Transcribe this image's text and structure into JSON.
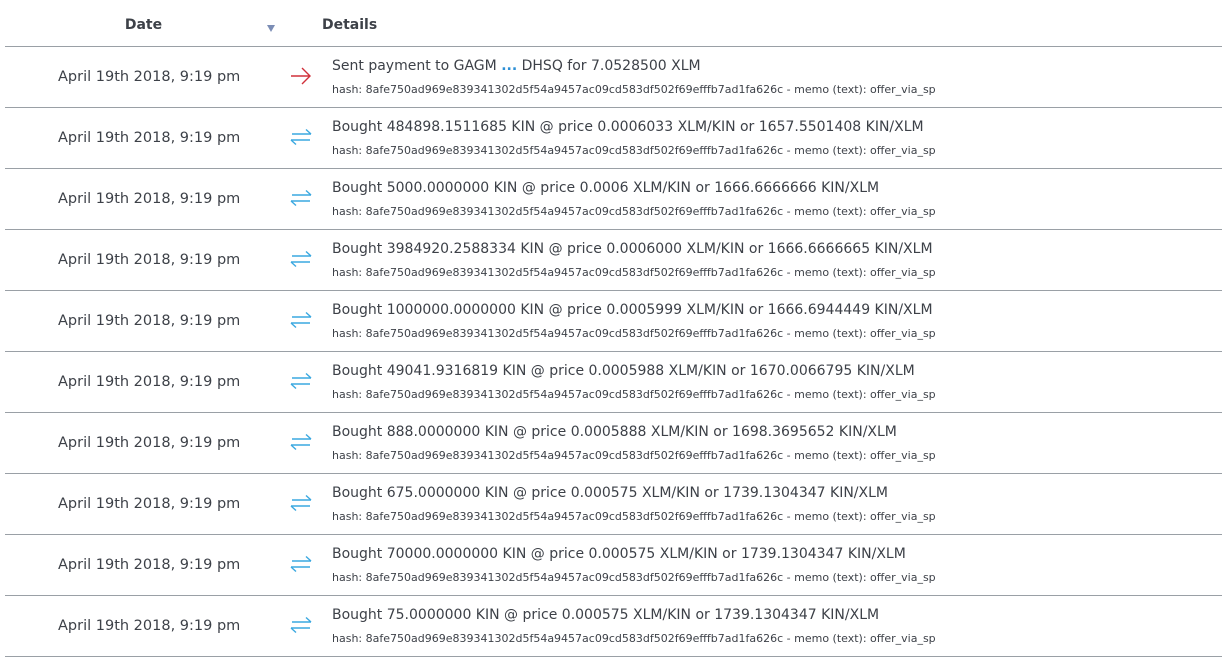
{
  "header": {
    "date_label": "Date",
    "details_label": "Details",
    "sort_icon": "sort-desc-icon"
  },
  "colors": {
    "payment_arrow": "#d0303a",
    "trade_arrows": "#3aa8e0",
    "ellipsis": "#2d8fd5",
    "divider": "#9aa0a6",
    "text": "#3d4148"
  },
  "rows": [
    {
      "date": "April 19th 2018, 9:19 pm",
      "icon": "arrow-right-icon",
      "main_prefix": "Sent payment to GAGM",
      "ellipsis": "...",
      "main_suffix": "DHSQ for 7.0528500 XLM",
      "sub": "hash: 8afe750ad969e839341302d5f54a9457ac09cd583df502f69efffb7ad1fa626c - memo (text): offer_via_sp"
    },
    {
      "date": "April 19th 2018, 9:19 pm",
      "icon": "swap-arrows-icon",
      "main": "Bought 484898.1511685 KIN @ price 0.0006033 XLM/KIN or 1657.5501408 KIN/XLM",
      "sub": "hash: 8afe750ad969e839341302d5f54a9457ac09cd583df502f69efffb7ad1fa626c - memo (text): offer_via_sp"
    },
    {
      "date": "April 19th 2018, 9:19 pm",
      "icon": "swap-arrows-icon",
      "main": "Bought 5000.0000000 KIN @ price 0.0006 XLM/KIN or 1666.6666666 KIN/XLM",
      "sub": "hash: 8afe750ad969e839341302d5f54a9457ac09cd583df502f69efffb7ad1fa626c - memo (text): offer_via_sp"
    },
    {
      "date": "April 19th 2018, 9:19 pm",
      "icon": "swap-arrows-icon",
      "main": "Bought 3984920.2588334 KIN @ price 0.0006000 XLM/KIN or 1666.6666665 KIN/XLM",
      "sub": "hash: 8afe750ad969e839341302d5f54a9457ac09cd583df502f69efffb7ad1fa626c - memo (text): offer_via_sp"
    },
    {
      "date": "April 19th 2018, 9:19 pm",
      "icon": "swap-arrows-icon",
      "main": "Bought 1000000.0000000 KIN @ price 0.0005999 XLM/KIN or 1666.6944449 KIN/XLM",
      "sub": "hash: 8afe750ad969e839341302d5f54a9457ac09cd583df502f69efffb7ad1fa626c - memo (text): offer_via_sp"
    },
    {
      "date": "April 19th 2018, 9:19 pm",
      "icon": "swap-arrows-icon",
      "main": "Bought 49041.9316819 KIN @ price 0.0005988 XLM/KIN or 1670.0066795 KIN/XLM",
      "sub": "hash: 8afe750ad969e839341302d5f54a9457ac09cd583df502f69efffb7ad1fa626c - memo (text): offer_via_sp"
    },
    {
      "date": "April 19th 2018, 9:19 pm",
      "icon": "swap-arrows-icon",
      "main": "Bought 888.0000000 KIN @ price 0.0005888 XLM/KIN or 1698.3695652 KIN/XLM",
      "sub": "hash: 8afe750ad969e839341302d5f54a9457ac09cd583df502f69efffb7ad1fa626c - memo (text): offer_via_sp"
    },
    {
      "date": "April 19th 2018, 9:19 pm",
      "icon": "swap-arrows-icon",
      "main": "Bought 675.0000000 KIN @ price 0.000575 XLM/KIN or 1739.1304347 KIN/XLM",
      "sub": "hash: 8afe750ad969e839341302d5f54a9457ac09cd583df502f69efffb7ad1fa626c - memo (text): offer_via_sp"
    },
    {
      "date": "April 19th 2018, 9:19 pm",
      "icon": "swap-arrows-icon",
      "main": "Bought 70000.0000000 KIN @ price 0.000575 XLM/KIN or 1739.1304347 KIN/XLM",
      "sub": "hash: 8afe750ad969e839341302d5f54a9457ac09cd583df502f69efffb7ad1fa626c - memo (text): offer_via_sp"
    },
    {
      "date": "April 19th 2018, 9:19 pm",
      "icon": "swap-arrows-icon",
      "main": "Bought 75.0000000 KIN @ price 0.000575 XLM/KIN or 1739.1304347 KIN/XLM",
      "sub": "hash: 8afe750ad969e839341302d5f54a9457ac09cd583df502f69efffb7ad1fa626c - memo (text): offer_via_sp"
    }
  ]
}
